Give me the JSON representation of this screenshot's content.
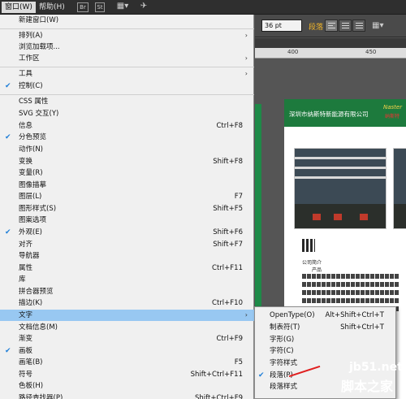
{
  "menubar": {
    "items": [
      "窗口(W)",
      "帮助(H)"
    ],
    "icon_labels": [
      "Br",
      "St"
    ]
  },
  "control_bar": {
    "font_size": "36 pt",
    "highlight_text": "段落"
  },
  "ruler": {
    "ticks": [
      "400",
      "450"
    ]
  },
  "document": {
    "company": "深圳市纳斯特新能源有限公司",
    "logo": "Naster",
    "logo_sub": "纳斯特",
    "section1": "公司简介",
    "section2": "产品"
  },
  "menu": {
    "items": [
      {
        "label": "新建窗口(W)",
        "shortcut": "",
        "submenu": false,
        "checked": false
      },
      {
        "label": "排列(A)",
        "shortcut": "",
        "submenu": true,
        "checked": false
      },
      {
        "label": "浏览加载项...",
        "shortcut": "",
        "submenu": false,
        "checked": false
      },
      {
        "label": "工作区",
        "shortcut": "",
        "submenu": true,
        "checked": false
      },
      {
        "label": "工具",
        "shortcut": "",
        "submenu": true,
        "checked": false
      },
      {
        "label": "控制(C)",
        "shortcut": "",
        "submenu": false,
        "checked": true
      },
      {
        "label": "CSS 属性",
        "shortcut": "",
        "submenu": false,
        "checked": false
      },
      {
        "label": "SVG 交互(Y)",
        "shortcut": "",
        "submenu": false,
        "checked": false
      },
      {
        "label": "信息",
        "shortcut": "Ctrl+F8",
        "submenu": false,
        "checked": false
      },
      {
        "label": "分色预览",
        "shortcut": "",
        "submenu": false,
        "checked": true
      },
      {
        "label": "动作(N)",
        "shortcut": "",
        "submenu": false,
        "checked": false
      },
      {
        "label": "变换",
        "shortcut": "Shift+F8",
        "submenu": false,
        "checked": false
      },
      {
        "label": "变量(R)",
        "shortcut": "",
        "submenu": false,
        "checked": false
      },
      {
        "label": "图像描摹",
        "shortcut": "",
        "submenu": false,
        "checked": false
      },
      {
        "label": "图层(L)",
        "shortcut": "F7",
        "submenu": false,
        "checked": false
      },
      {
        "label": "图形样式(S)",
        "shortcut": "Shift+F5",
        "submenu": false,
        "checked": false
      },
      {
        "label": "图案选项",
        "shortcut": "",
        "submenu": false,
        "checked": false
      },
      {
        "label": "外观(E)",
        "shortcut": "Shift+F6",
        "submenu": false,
        "checked": true
      },
      {
        "label": "对齐",
        "shortcut": "Shift+F7",
        "submenu": false,
        "checked": false
      },
      {
        "label": "导航器",
        "shortcut": "",
        "submenu": false,
        "checked": false
      },
      {
        "label": "属性",
        "shortcut": "Ctrl+F11",
        "submenu": false,
        "checked": false
      },
      {
        "label": "库",
        "shortcut": "",
        "submenu": false,
        "checked": false
      },
      {
        "label": "拼合器预览",
        "shortcut": "",
        "submenu": false,
        "checked": false
      },
      {
        "label": "描边(K)",
        "shortcut": "Ctrl+F10",
        "submenu": false,
        "checked": false
      },
      {
        "label": "文字",
        "shortcut": "",
        "submenu": true,
        "checked": false
      },
      {
        "label": "文档信息(M)",
        "shortcut": "",
        "submenu": false,
        "checked": false
      },
      {
        "label": "渐变",
        "shortcut": "Ctrl+F9",
        "submenu": false,
        "checked": false
      },
      {
        "label": "画板",
        "shortcut": "",
        "submenu": false,
        "checked": true
      },
      {
        "label": "画笔(B)",
        "shortcut": "F5",
        "submenu": false,
        "checked": false
      },
      {
        "label": "符号",
        "shortcut": "Shift+Ctrl+F11",
        "submenu": false,
        "checked": false
      },
      {
        "label": "色板(H)",
        "shortcut": "",
        "submenu": false,
        "checked": false
      },
      {
        "label": "路径查找器(P)",
        "shortcut": "Shift+Ctrl+F9",
        "submenu": false,
        "checked": false
      }
    ]
  },
  "submenu": {
    "items": [
      {
        "label": "OpenType(O)",
        "shortcut": "Alt+Shift+Ctrl+T",
        "checked": false
      },
      {
        "label": "制表符(T)",
        "shortcut": "Shift+Ctrl+T",
        "checked": false
      },
      {
        "label": "字形(G)",
        "shortcut": "",
        "checked": false
      },
      {
        "label": "字符(C)",
        "shortcut": "",
        "checked": false
      },
      {
        "label": "字符样式",
        "shortcut": "",
        "checked": false
      },
      {
        "label": "段落(P)",
        "shortcut": "",
        "checked": true
      },
      {
        "label": "段落样式",
        "shortcut": "",
        "checked": false
      }
    ]
  },
  "watermark": {
    "line1": "jb51.net",
    "line2": "脚本之家"
  }
}
